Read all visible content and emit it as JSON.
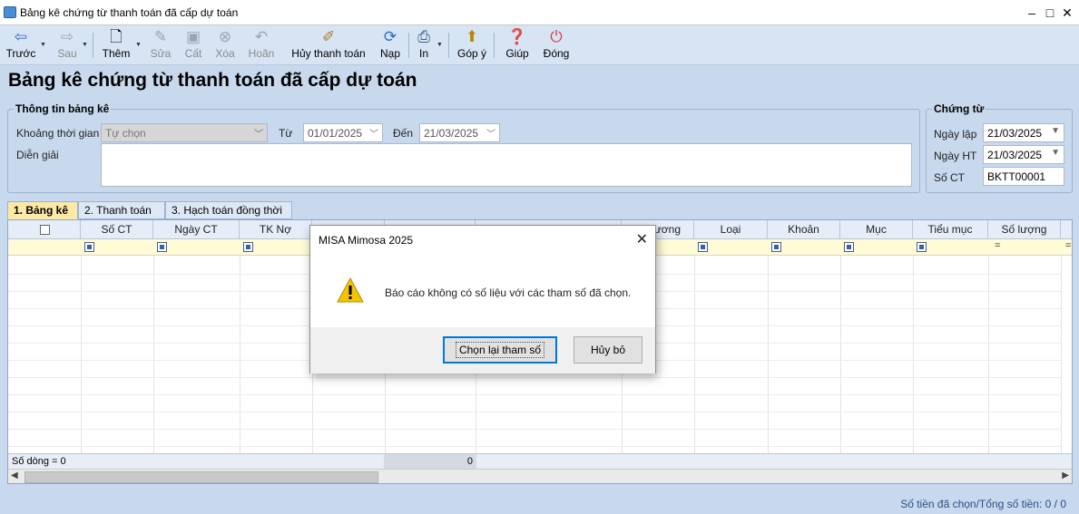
{
  "window": {
    "title": "Bảng kê chứng từ thanh toán đã cấp dự toán"
  },
  "toolbar": {
    "back": "Trước",
    "next": "Sau",
    "add": "Thêm",
    "edit": "Sửa",
    "save": "Cất",
    "delete": "Xóa",
    "undo": "Hoãn",
    "cancel_pay": "Hủy thanh toán",
    "reload": "Nạp",
    "print": "In",
    "feedback": "Góp ý",
    "help": "Giúp",
    "close": "Đóng"
  },
  "page": {
    "title": "Bảng kê chứng từ thanh toán đã cấp dự toán"
  },
  "info": {
    "legend": "Thông tin bảng kê",
    "period_label": "Khoảng thời gian",
    "period_value": "Tự chọn",
    "from_label": "Từ",
    "from_value": "01/01/2025",
    "to_label": "Đến",
    "to_value": "21/03/2025",
    "desc_label": "Diễn giải",
    "desc_value": ""
  },
  "voucher": {
    "legend": "Chứng từ",
    "date_label": "Ngày lập",
    "date_value": "21/03/2025",
    "ht_label": "Ngày HT",
    "ht_value": "21/03/2025",
    "no_label": "Số CT",
    "no_value": "BKTT00001"
  },
  "tabs": [
    {
      "label": "1. Bảng kê"
    },
    {
      "label": "2. Thanh toán"
    },
    {
      "label": "3. Hạch toán đồng thời"
    }
  ],
  "grid": {
    "columns": [
      "Số CT",
      "Ngày CT",
      "TK Nợ",
      "",
      "",
      "",
      "...ương",
      "Loại",
      "Khoản",
      "Mục",
      "Tiểu mục",
      "Số lượng"
    ],
    "row_count_label": "Số dòng = 0",
    "total": "0"
  },
  "status": {
    "text": "Số tiền đã chọn/Tổng số tiền: 0 / 0"
  },
  "dialog": {
    "title": "MISA Mimosa 2025",
    "message": "Báo cáo không có số liệu với các tham số đã chọn.",
    "primary": "Chọn lại tham số",
    "secondary": "Hủy bỏ"
  }
}
